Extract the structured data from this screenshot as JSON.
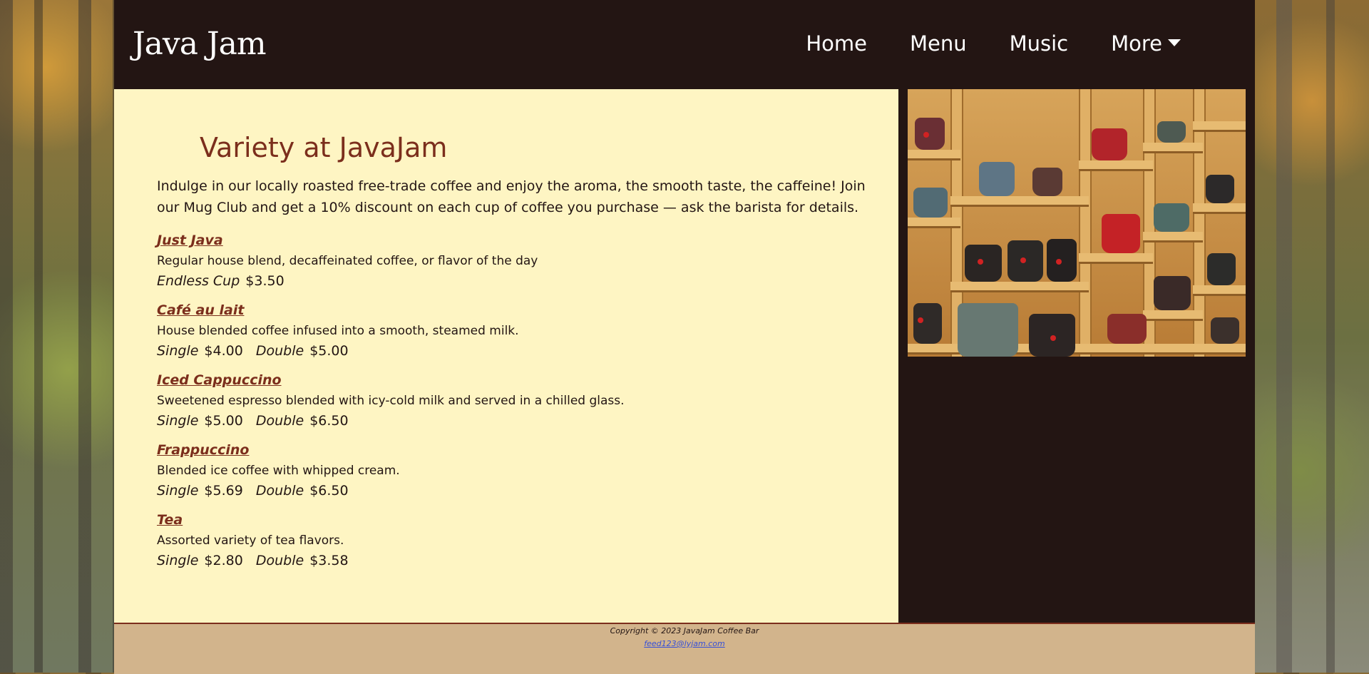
{
  "site": {
    "logo": "Java Jam"
  },
  "nav": [
    {
      "label": "Home"
    },
    {
      "label": "Menu"
    },
    {
      "label": "Music"
    },
    {
      "label": "More"
    }
  ],
  "main": {
    "title": "Variety at JavaJam",
    "intro": "Indulge in our locally roasted free-trade coffee and enjoy the aroma, the smooth taste, the caffeine! Join our Mug Club and get a 10% discount on each cup of coffee you purchase — ask the barista for details.",
    "items": [
      {
        "name": "Just Java",
        "description": "Regular house blend, decaffeinated coffee, or flavor of the day",
        "prices": [
          {
            "label": "Endless Cup",
            "amount": "$3.50"
          }
        ]
      },
      {
        "name": "Café au lait",
        "description": "House blended coffee infused into a smooth, steamed milk.",
        "prices": [
          {
            "label": "Single",
            "amount": "$4.00"
          },
          {
            "label": "Double",
            "amount": "$5.00"
          }
        ]
      },
      {
        "name": "Iced Cappuccino",
        "description": "Sweetened espresso blended with icy-cold milk and served in a chilled glass.",
        "prices": [
          {
            "label": "Single",
            "amount": "$5.00"
          },
          {
            "label": "Double",
            "amount": "$6.50"
          }
        ]
      },
      {
        "name": "Frappuccino",
        "description": "Blended ice coffee with whipped cream.",
        "prices": [
          {
            "label": "Single",
            "amount": "$5.69"
          },
          {
            "label": "Double",
            "amount": "$6.50"
          }
        ]
      },
      {
        "name": "Tea",
        "description": "Assorted variety of tea flavors.",
        "prices": [
          {
            "label": "Single",
            "amount": "$2.80"
          },
          {
            "label": "Double",
            "amount": "$3.58"
          }
        ]
      }
    ]
  },
  "footer": {
    "copyright": "Copyright © 2023 JavaJam Coffee Bar",
    "email": "feed123@lyjam.com"
  },
  "colors": {
    "header_bg": "#231513",
    "content_bg": "#fef5c3",
    "accent": "#7b2e1c",
    "footer_bg": "#d2b48c"
  }
}
